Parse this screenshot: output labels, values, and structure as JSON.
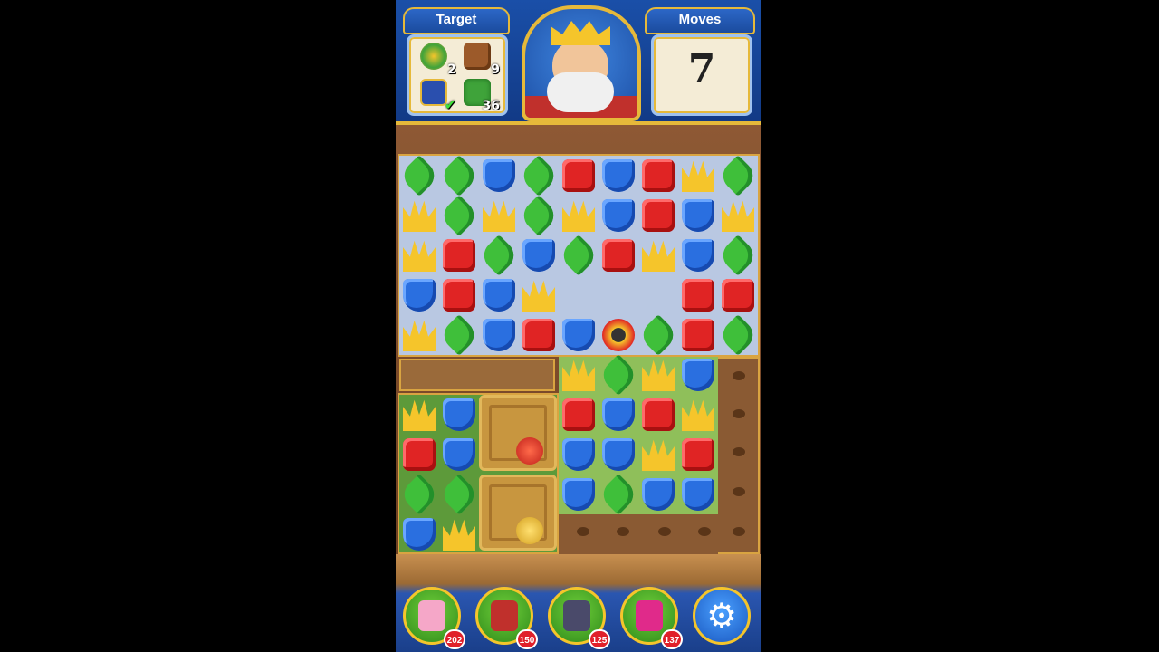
{
  "header": {
    "target_label": "Target",
    "moves_label": "Moves",
    "moves_value": "7",
    "goals": [
      {
        "icon": "potion-jar-icon",
        "count": "2",
        "color": "#e4a23a"
      },
      {
        "icon": "wood-block-icon",
        "count": "9",
        "color": "#9c5a2a"
      },
      {
        "icon": "tv-box-icon",
        "count": "",
        "color": "#2a4fae",
        "completed": true
      },
      {
        "icon": "grass-tile-icon",
        "count": "36",
        "color": "#3fa33a"
      }
    ]
  },
  "colors": {
    "leaf": "#3fbf3a",
    "shield": "#2a6fe0",
    "box": "#e02424",
    "crown": "#f5c52b",
    "frame_gold": "#e6b93a",
    "header_blue": "#1a4fa8"
  },
  "board": {
    "top_rows": [
      [
        "leaf",
        "leaf",
        "shield",
        "leaf",
        "box",
        "shield",
        "box",
        "crown",
        "leaf"
      ],
      [
        "crown",
        "leaf",
        "crown",
        "leaf",
        "crown",
        "shield",
        "box",
        "shield",
        "crown"
      ],
      [
        "crown",
        "box",
        "leaf",
        "shield",
        "leaf",
        "box",
        "crown",
        "shield",
        "leaf"
      ],
      [
        "shield",
        "box",
        "shield",
        "crown",
        "",
        "",
        "",
        "box",
        "box"
      ],
      [
        "crown",
        "leaf",
        "shield",
        "box",
        "shield",
        "cannon",
        "leaf",
        "box",
        "leaf"
      ]
    ],
    "mid_rows": [
      [
        "crown",
        "leaf",
        "crown",
        "shield"
      ],
      [
        "box",
        "shield",
        "box",
        "crown"
      ],
      [
        "shield",
        "shield",
        "crown",
        "box"
      ],
      [
        "shield",
        "leaf",
        "shield",
        "shield"
      ]
    ],
    "left_rows": [
      [
        "crown",
        "shield"
      ],
      [
        "box",
        "shield"
      ],
      [
        "leaf",
        "leaf"
      ],
      [
        "shield",
        "crown"
      ]
    ]
  },
  "boosters": [
    {
      "icon": "hammer-icon",
      "count": "202",
      "color": "#f5a7c8"
    },
    {
      "icon": "arrow-icon",
      "count": "150",
      "color": "#c0302c"
    },
    {
      "icon": "cannon-icon",
      "count": "125",
      "color": "#4a4a6a"
    },
    {
      "icon": "jester-hat-icon",
      "count": "137",
      "color": "#e02a8a"
    }
  ],
  "settings_icon": "gear-icon"
}
